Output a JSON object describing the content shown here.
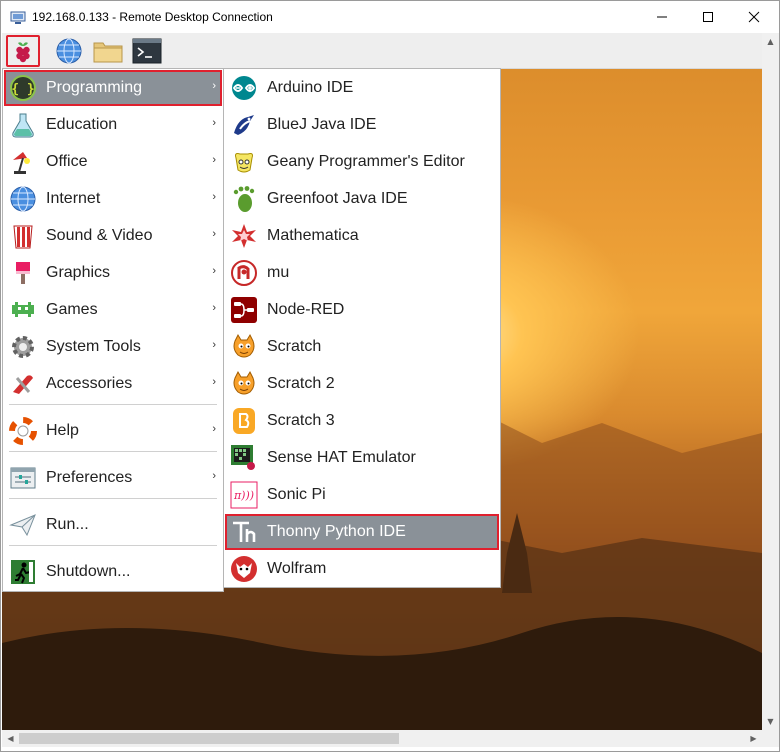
{
  "window": {
    "title": "192.168.0.133 - Remote Desktop Connection",
    "minimize_icon": "minimize-icon",
    "maximize_icon": "maximize-icon",
    "close_icon": "close-icon"
  },
  "taskbar": {
    "buttons": [
      "raspberry-menu-icon",
      "web-browser-icon",
      "file-manager-icon",
      "terminal-icon"
    ]
  },
  "main_menu": {
    "items": [
      {
        "label": "Programming",
        "icon": "programming-icon",
        "submenu": true
      },
      {
        "label": "Education",
        "icon": "education-icon",
        "submenu": true
      },
      {
        "label": "Office",
        "icon": "office-icon",
        "submenu": true
      },
      {
        "label": "Internet",
        "icon": "internet-icon",
        "submenu": true
      },
      {
        "label": "Sound & Video",
        "icon": "sound-video-icon",
        "submenu": true
      },
      {
        "label": "Graphics",
        "icon": "graphics-icon",
        "submenu": true
      },
      {
        "label": "Games",
        "icon": "games-icon",
        "submenu": true
      },
      {
        "label": "System Tools",
        "icon": "system-tools-icon",
        "submenu": true
      },
      {
        "label": "Accessories",
        "icon": "accessories-icon",
        "submenu": true
      },
      {
        "label": "Help",
        "icon": "help-icon",
        "submenu": true
      },
      {
        "label": "Preferences",
        "icon": "preferences-icon",
        "submenu": true
      },
      {
        "label": "Run...",
        "icon": "run-icon",
        "submenu": false
      },
      {
        "label": "Shutdown...",
        "icon": "shutdown-icon",
        "submenu": false
      }
    ],
    "arrow": "›"
  },
  "programming_menu": {
    "items": [
      {
        "label": "Arduino IDE",
        "icon": "arduino-icon"
      },
      {
        "label": "BlueJ Java IDE",
        "icon": "bluej-icon"
      },
      {
        "label": "Geany Programmer's Editor",
        "icon": "geany-icon"
      },
      {
        "label": "Greenfoot Java IDE",
        "icon": "greenfoot-icon"
      },
      {
        "label": "Mathematica",
        "icon": "mathematica-icon"
      },
      {
        "label": "mu",
        "icon": "mu-icon"
      },
      {
        "label": "Node-RED",
        "icon": "node-red-icon"
      },
      {
        "label": "Scratch",
        "icon": "scratch-icon"
      },
      {
        "label": "Scratch 2",
        "icon": "scratch2-icon"
      },
      {
        "label": "Scratch 3",
        "icon": "scratch3-icon"
      },
      {
        "label": "Sense HAT Emulator",
        "icon": "sense-hat-icon"
      },
      {
        "label": "Sonic Pi",
        "icon": "sonic-pi-icon"
      },
      {
        "label": "Thonny Python IDE",
        "icon": "thonny-icon"
      },
      {
        "label": "Wolfram",
        "icon": "wolfram-icon"
      }
    ]
  },
  "colors": {
    "highlight_outline": "#e0202e",
    "active_item_bg": "#8a9198"
  }
}
